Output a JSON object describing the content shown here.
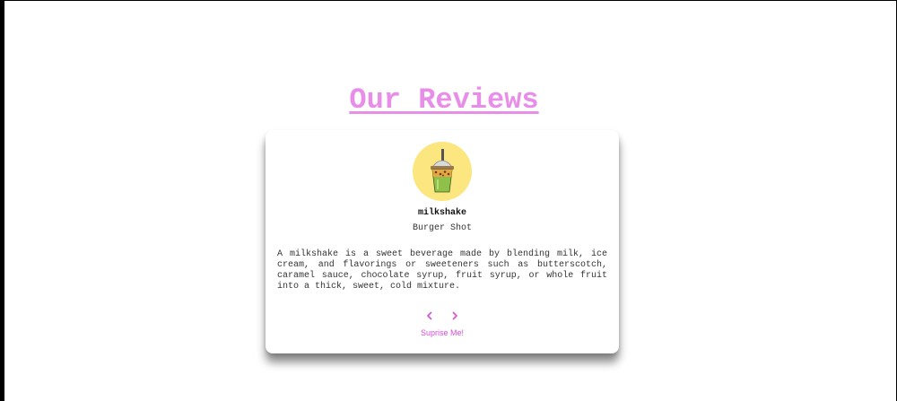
{
  "header": {
    "title": "Our Reviews"
  },
  "review": {
    "author": "milkshake",
    "job": "Burger Shot",
    "text": "A milkshake is a sweet beverage made by blending milk, ice cream, and flavorings or sweeteners such as butterscotch, caramel sauce, chocolate syrup, fruit syrup, or whole fruit into a thick, sweet, cold mixture.",
    "image_icon": "milkshake-cup-icon"
  },
  "controls": {
    "prev_icon": "chevron-left-icon",
    "next_icon": "chevron-right-icon",
    "random_label": "Suprise Me!"
  },
  "colors": {
    "accent": "#e88ee9",
    "accent_dark": "#d84fd8",
    "avatar_bg": "#fbe680"
  }
}
